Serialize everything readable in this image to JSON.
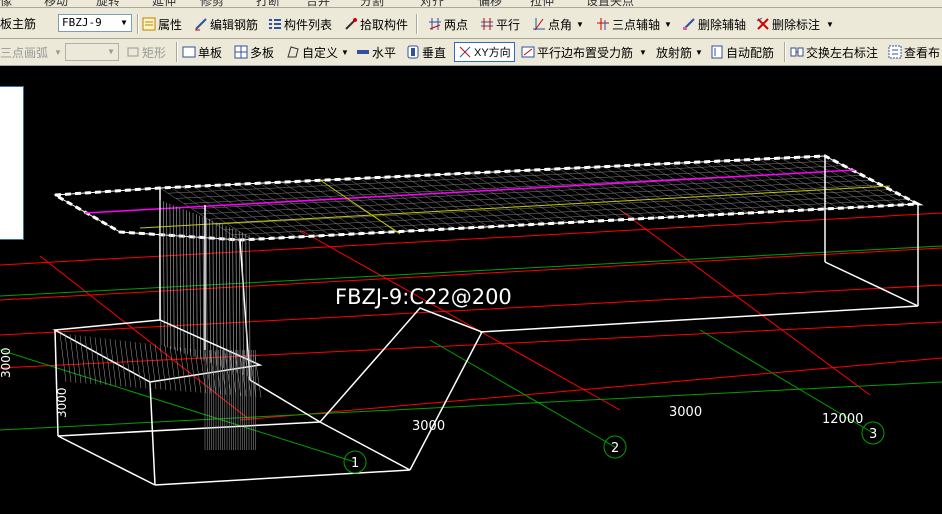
{
  "toolbar_top_clipped": [
    "像",
    "移动",
    "旋转",
    "延伸",
    "修剪",
    "打断",
    "合并",
    "分割",
    "对齐",
    "偏移",
    "拉伸",
    "设置夹点"
  ],
  "toolbar1": {
    "rebar_type_label": "板主筋",
    "component_select": "FBZJ-9",
    "attributes": "属性",
    "edit_rebar": "编辑钢筋",
    "component_list": "构件列表",
    "pick_component": "拾取构件",
    "two_points": "两点",
    "parallel": "平行",
    "point_angle": "点角",
    "three_point_axis": "三点辅轴",
    "delete_axis": "删除辅轴",
    "delete_label": "删除标注"
  },
  "toolbar2": {
    "three_point_arc": "三点画弧",
    "rect": "矩形",
    "single_board": "单板",
    "multi_board": "多板",
    "custom": "自定义",
    "horizontal": "水平",
    "vertical": "垂直",
    "xy_direction": "XY方向",
    "parallel_edge": "平行边布置受力筋",
    "radial": "放射筋",
    "auto_rebar": "自动配筋",
    "swap_lr": "交换左右标注",
    "view": "查看布"
  },
  "drawing": {
    "rebar_label": "FBZJ-9:C22@200",
    "dim_left_1": "3000",
    "dim_left_2": "3000",
    "dim_mid": "3000",
    "dim_right_1": "3000",
    "dim_right_2": "12000",
    "axis_1": "1",
    "axis_2": "2",
    "axis_3": "3"
  },
  "colors": {
    "background": "#000000",
    "wire": "#FFFFFF",
    "axis_red": "#FF0000",
    "axis_green": "#00A000",
    "magenta": "#FF00FF",
    "yellow": "#C8C800"
  }
}
